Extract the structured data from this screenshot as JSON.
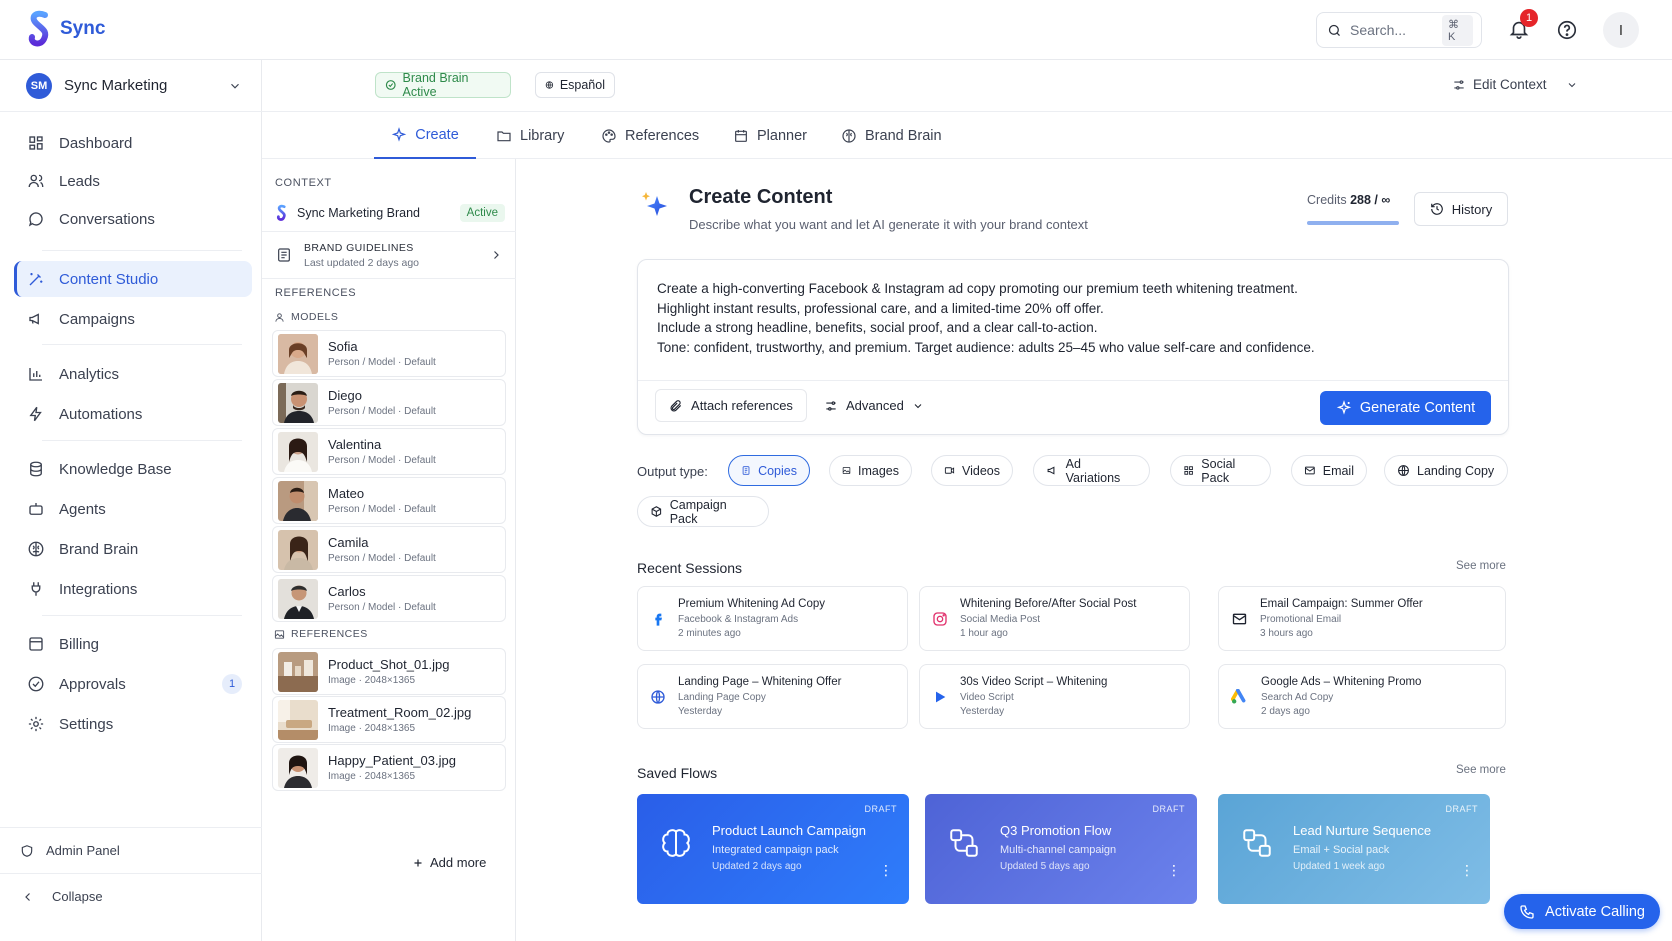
{
  "app": {
    "name": "Sync"
  },
  "topbar": {
    "search_placeholder": "Search...",
    "search_shortcut": "⌘ K",
    "notifications_count": "1",
    "user_initial": "I"
  },
  "workspace": {
    "initials": "SM",
    "name": "Sync Marketing"
  },
  "nav": [
    {
      "label": "Dashboard",
      "icon": "grid-icon"
    },
    {
      "label": "Leads",
      "icon": "users-icon"
    },
    {
      "label": "Conversations",
      "icon": "chat-icon"
    },
    {
      "label": "Content Studio",
      "icon": "magic-wand-icon",
      "active": true
    },
    {
      "label": "Campaigns",
      "icon": "megaphone-icon"
    },
    {
      "label": "Analytics",
      "icon": "bar-chart-icon"
    },
    {
      "label": "Automations",
      "icon": "lightning-icon"
    },
    {
      "label": "Knowledge Base",
      "icon": "database-icon"
    },
    {
      "label": "Agents",
      "icon": "bot-icon"
    },
    {
      "label": "Brand Brain",
      "icon": "brain-icon"
    },
    {
      "label": "Integrations",
      "icon": "plug-icon"
    },
    {
      "label": "Billing",
      "icon": "receipt-icon"
    },
    {
      "label": "Approvals",
      "icon": "check-circle-icon",
      "badge": "1"
    },
    {
      "label": "Settings",
      "icon": "gear-icon"
    }
  ],
  "sidebar_bottom": {
    "admin": "Admin Panel",
    "collapse": "Collapse"
  },
  "contextbar": {
    "brand_brain": "Brand Brain Active",
    "language": "Español",
    "edit_context": "Edit Context"
  },
  "tabs": [
    {
      "label": "Create",
      "active": true
    },
    {
      "label": "Library"
    },
    {
      "label": "References"
    },
    {
      "label": "Planner"
    },
    {
      "label": "Brand Brain"
    }
  ],
  "context_panel": {
    "context_label": "CONTEXT",
    "brand_name": "Sync Marketing Brand",
    "brand_status": "Active",
    "guidelines_title": "BRAND GUIDELINES",
    "guidelines_updated": "Last updated 2 days ago",
    "references_label": "REFERENCES",
    "models_label": "MODELS",
    "models": [
      {
        "name": "Sofia",
        "meta": "Person / Model · Default"
      },
      {
        "name": "Diego",
        "meta": "Person / Model · Default"
      },
      {
        "name": "Valentina",
        "meta": "Person / Model · Default"
      },
      {
        "name": "Mateo",
        "meta": "Person / Model · Default"
      },
      {
        "name": "Camila",
        "meta": "Person / Model · Default"
      },
      {
        "name": "Carlos",
        "meta": "Person / Model · Default"
      }
    ],
    "refs_label": "REFERENCES",
    "refs": [
      {
        "name": "Product_Shot_01.jpg",
        "meta": "Image · 2048×1365"
      },
      {
        "name": "Treatment_Room_02.jpg",
        "meta": "Image · 2048×1365"
      },
      {
        "name": "Happy_Patient_03.jpg",
        "meta": "Image · 2048×1365"
      }
    ],
    "add_more": "Add more"
  },
  "create": {
    "title": "Create Content",
    "subtitle": "Describe what you want and let AI generate it with your brand context",
    "credits_label": "Credits",
    "credits_value": "288 / ∞",
    "history": "History",
    "prompt": "Create a high-converting Facebook & Instagram ad copy promoting our premium teeth whitening treatment.\nHighlight instant results, professional care, and a limited-time 20% off offer.\nInclude a strong headline, benefits, social proof, and a clear call-to-action.\nTone: confident, trustworthy, and premium. Target audience: adults 25–45 who value self-care and confidence.",
    "attach": "Attach references",
    "advanced": "Advanced",
    "generate": "Generate Content",
    "output_type_label": "Output type:",
    "output_types": [
      {
        "label": "Copies",
        "icon": "document-icon",
        "active": true
      },
      {
        "label": "Images",
        "icon": "image-icon"
      },
      {
        "label": "Videos",
        "icon": "video-icon"
      },
      {
        "label": "Ad Variations",
        "icon": "megaphone-icon"
      },
      {
        "label": "Social Pack",
        "icon": "grid-icon"
      },
      {
        "label": "Email",
        "icon": "mail-icon"
      },
      {
        "label": "Landing Copy",
        "icon": "globe-icon"
      },
      {
        "label": "Campaign Pack",
        "icon": "package-icon"
      }
    ]
  },
  "recent": {
    "title": "Recent Sessions",
    "see_more": "See more",
    "sessions": [
      {
        "title": "Premium Whitening Ad Copy",
        "sub": "Facebook & Instagram Ads",
        "time": "2 minutes ago",
        "icon": "facebook-icon"
      },
      {
        "title": "Whitening Before/After Social Post",
        "sub": "Social Media Post",
        "time": "1 hour ago",
        "icon": "instagram-icon"
      },
      {
        "title": "Email Campaign: Summer Offer",
        "sub": "Promotional Email",
        "time": "3 hours ago",
        "icon": "mail-icon"
      },
      {
        "title": "Landing Page – Whitening Offer",
        "sub": "Landing Page Copy",
        "time": "Yesterday",
        "icon": "globe-icon"
      },
      {
        "title": "30s Video Script – Whitening",
        "sub": "Video Script",
        "time": "Yesterday",
        "icon": "play-icon"
      },
      {
        "title": "Google Ads – Whitening Promo",
        "sub": "Search Ad Copy",
        "time": "2 days ago",
        "icon": "google-ads-icon"
      }
    ]
  },
  "flows": {
    "title": "Saved Flows",
    "see_more": "See more",
    "items": [
      {
        "title": "Product Launch Campaign",
        "sub": "Integrated campaign pack",
        "time": "Updated 2 days ago",
        "badge": "DRAFT"
      },
      {
        "title": "Q3 Promotion Flow",
        "sub": "Multi-channel campaign",
        "time": "Updated 5 days ago",
        "badge": "DRAFT"
      },
      {
        "title": "Lead Nurture Sequence",
        "sub": "Email + Social pack",
        "time": "Updated 1 week ago",
        "badge": "DRAFT"
      }
    ]
  },
  "activate_calling": "Activate Calling",
  "colors": {
    "primary": "#2563eb",
    "brand_blue": "#2f5bd8",
    "success": "#2e8a4a",
    "danger": "#e5252a"
  }
}
